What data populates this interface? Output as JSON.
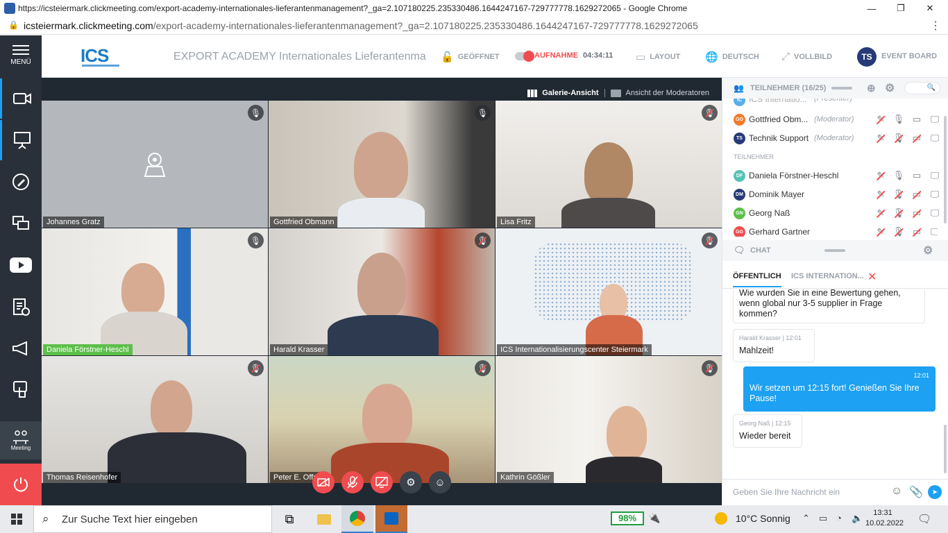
{
  "browser": {
    "window_title": "https://icsteiermark.clickmeeting.com/export-academy-internationales-lieferantenmanagement?_ga=2.107180225.235330486.1644247167-729777778.1629272065 - Google Chrome",
    "url_host": "icsteiermark.clickmeeting.com",
    "url_rest": "/export-academy-internationales-lieferantenmanagement?_ga=2.107180225.235330486.1644247167-729777778.1629272065",
    "btn_minimize": "—",
    "btn_restore": "❐",
    "btn_close": "✕"
  },
  "nav": {
    "menu_label": "MENÜ",
    "meeting_label": "Meeting",
    "icons": [
      "camera-icon",
      "presentation-icon",
      "pen-icon",
      "screen-share-icon",
      "youtube-icon",
      "clipboard-icon",
      "megaphone-icon",
      "touch-icon",
      "meeting-icon",
      "power-icon"
    ]
  },
  "header": {
    "logo_text": "ICS",
    "event_title": "EXPORT ACADEMY Internationales Lieferantenma...",
    "status_open": "GEÖFFNET",
    "recording_label": "AUFNAHME",
    "recording_time": "04:34:11",
    "layout_label": "LAYOUT",
    "language_label": "DEUTSCH",
    "fullscreen_label": "VOLLBILD",
    "event_board_initials": "TS",
    "event_board_label": "EVENT BOARD"
  },
  "stage": {
    "gallery_view": "Galerie-Ansicht",
    "moderator_view": "Ansicht der Moderatoren",
    "tiles": [
      {
        "name": "Johannes Gratz",
        "muted": false
      },
      {
        "name": "Gottfried Obmann",
        "muted": false
      },
      {
        "name": "Lisa Fritz",
        "muted": true
      },
      {
        "name": "Daniela Förstner-Heschl",
        "muted": false
      },
      {
        "name": "Harald Krasser",
        "muted": true
      },
      {
        "name": "ICS Internationalisierungscenter Steiermark",
        "muted": true
      },
      {
        "name": "Thomas Reisenhofer",
        "muted": true
      },
      {
        "name": "Peter E. Offner",
        "muted": true
      },
      {
        "name": "Kathrin Gößler",
        "muted": true
      }
    ],
    "controls": [
      "camera-off-icon",
      "mic-off-icon",
      "screen-off-icon",
      "settings-icon",
      "emoji-icon"
    ]
  },
  "participants": {
    "header_label": "TEILNEHMER (16/25)",
    "section_label": "TEILNEHMER",
    "rows": [
      {
        "initials": "IC",
        "name": "ICS Internatio...",
        "role": "(Presenter)",
        "color": "#5aaee8"
      },
      {
        "initials": "GO",
        "name": "Gottfried Obm...",
        "role": "(Moderator)",
        "color": "#f07b2b"
      },
      {
        "initials": "TS",
        "name": "Technik Support",
        "role": "(Moderator)",
        "color": "#273a78"
      },
      {
        "initials": "DF",
        "name": "Daniela Förstner-Heschl",
        "role": "",
        "color": "#54c3b4"
      },
      {
        "initials": "DM",
        "name": "Dominik Mayer",
        "role": "",
        "color": "#273a78"
      },
      {
        "initials": "GN",
        "name": "Georg Naß",
        "role": "",
        "color": "#5cbf4a"
      },
      {
        "initials": "GG",
        "name": "Gerhard Gartner",
        "role": "",
        "color": "#f04c4f"
      }
    ]
  },
  "chat": {
    "header_label": "CHAT",
    "tab_public": "ÖFFENTLICH",
    "tab_private": "ICS INTERNATION...",
    "messages": [
      {
        "sender": "",
        "time": "",
        "text": "Wie wurden Sie in eine Bewertung gehen, wenn global nur 3-5 supplier in Frage kommen?",
        "own": false
      },
      {
        "sender": "Harald Krasser",
        "time": "12:01",
        "text": "Mahlzeit!",
        "own": false
      },
      {
        "sender": "",
        "time": "12:01",
        "text": "Wir setzen um 12:15 fort! Genießen Sie Ihre Pause!",
        "own": true
      },
      {
        "sender": "Georg Naß",
        "time": "12:15",
        "text": "Wieder bereit",
        "own": false
      }
    ],
    "input_placeholder": "Geben Sie Ihre Nachricht ein"
  },
  "taskbar": {
    "search_placeholder": "Zur Suche Text hier eingeben",
    "battery": "98%",
    "weather": "10°C  Sonnig",
    "time": "13:31",
    "date": "10.02.2022"
  },
  "colors": {
    "accent": "#1da1f2",
    "record": "#f04c4f",
    "nav_bg": "#293039",
    "stage_bg": "#202832",
    "speaking": "#5cbf4a"
  }
}
